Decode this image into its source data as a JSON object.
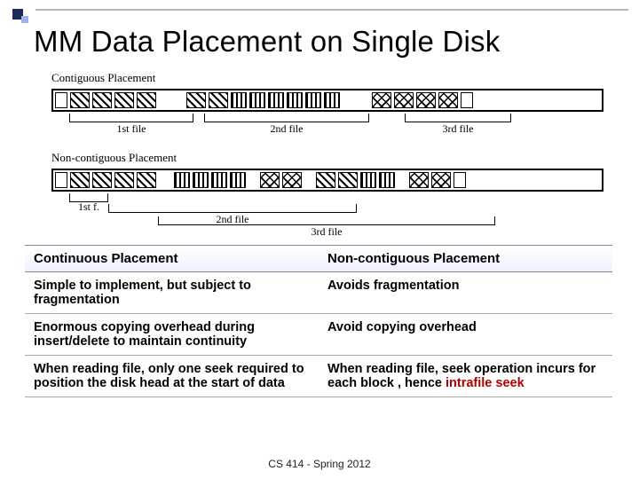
{
  "title": "MM Data Placement on Single Disk",
  "diagram": {
    "label_contig": "Contiguous Placement",
    "label_noncontig": "Non-contiguous Placement",
    "contig_brackets": {
      "b1": "1st file",
      "b2": "2nd file",
      "b3": "3rd file"
    },
    "noncontig_brackets": {
      "b1": "1st f.",
      "b2": "2nd file",
      "b3": "3rd file"
    }
  },
  "table": {
    "headers": {
      "left": "Continuous Placement",
      "right": "Non-contiguous Placement"
    },
    "rows": [
      {
        "left": "Simple to implement, but subject to fragmentation",
        "right": "Avoids fragmentation"
      },
      {
        "left": "Enormous copying overhead during insert/delete to maintain continuity",
        "right": "Avoid copying overhead"
      },
      {
        "left": "When reading file, only one seek required to position the disk head at the start of data",
        "right_pre": "When reading file, seek operation incurs for each block , hence ",
        "right_hl": "intrafile seek"
      }
    ]
  },
  "footer": "CS 414 - Spring 2012"
}
